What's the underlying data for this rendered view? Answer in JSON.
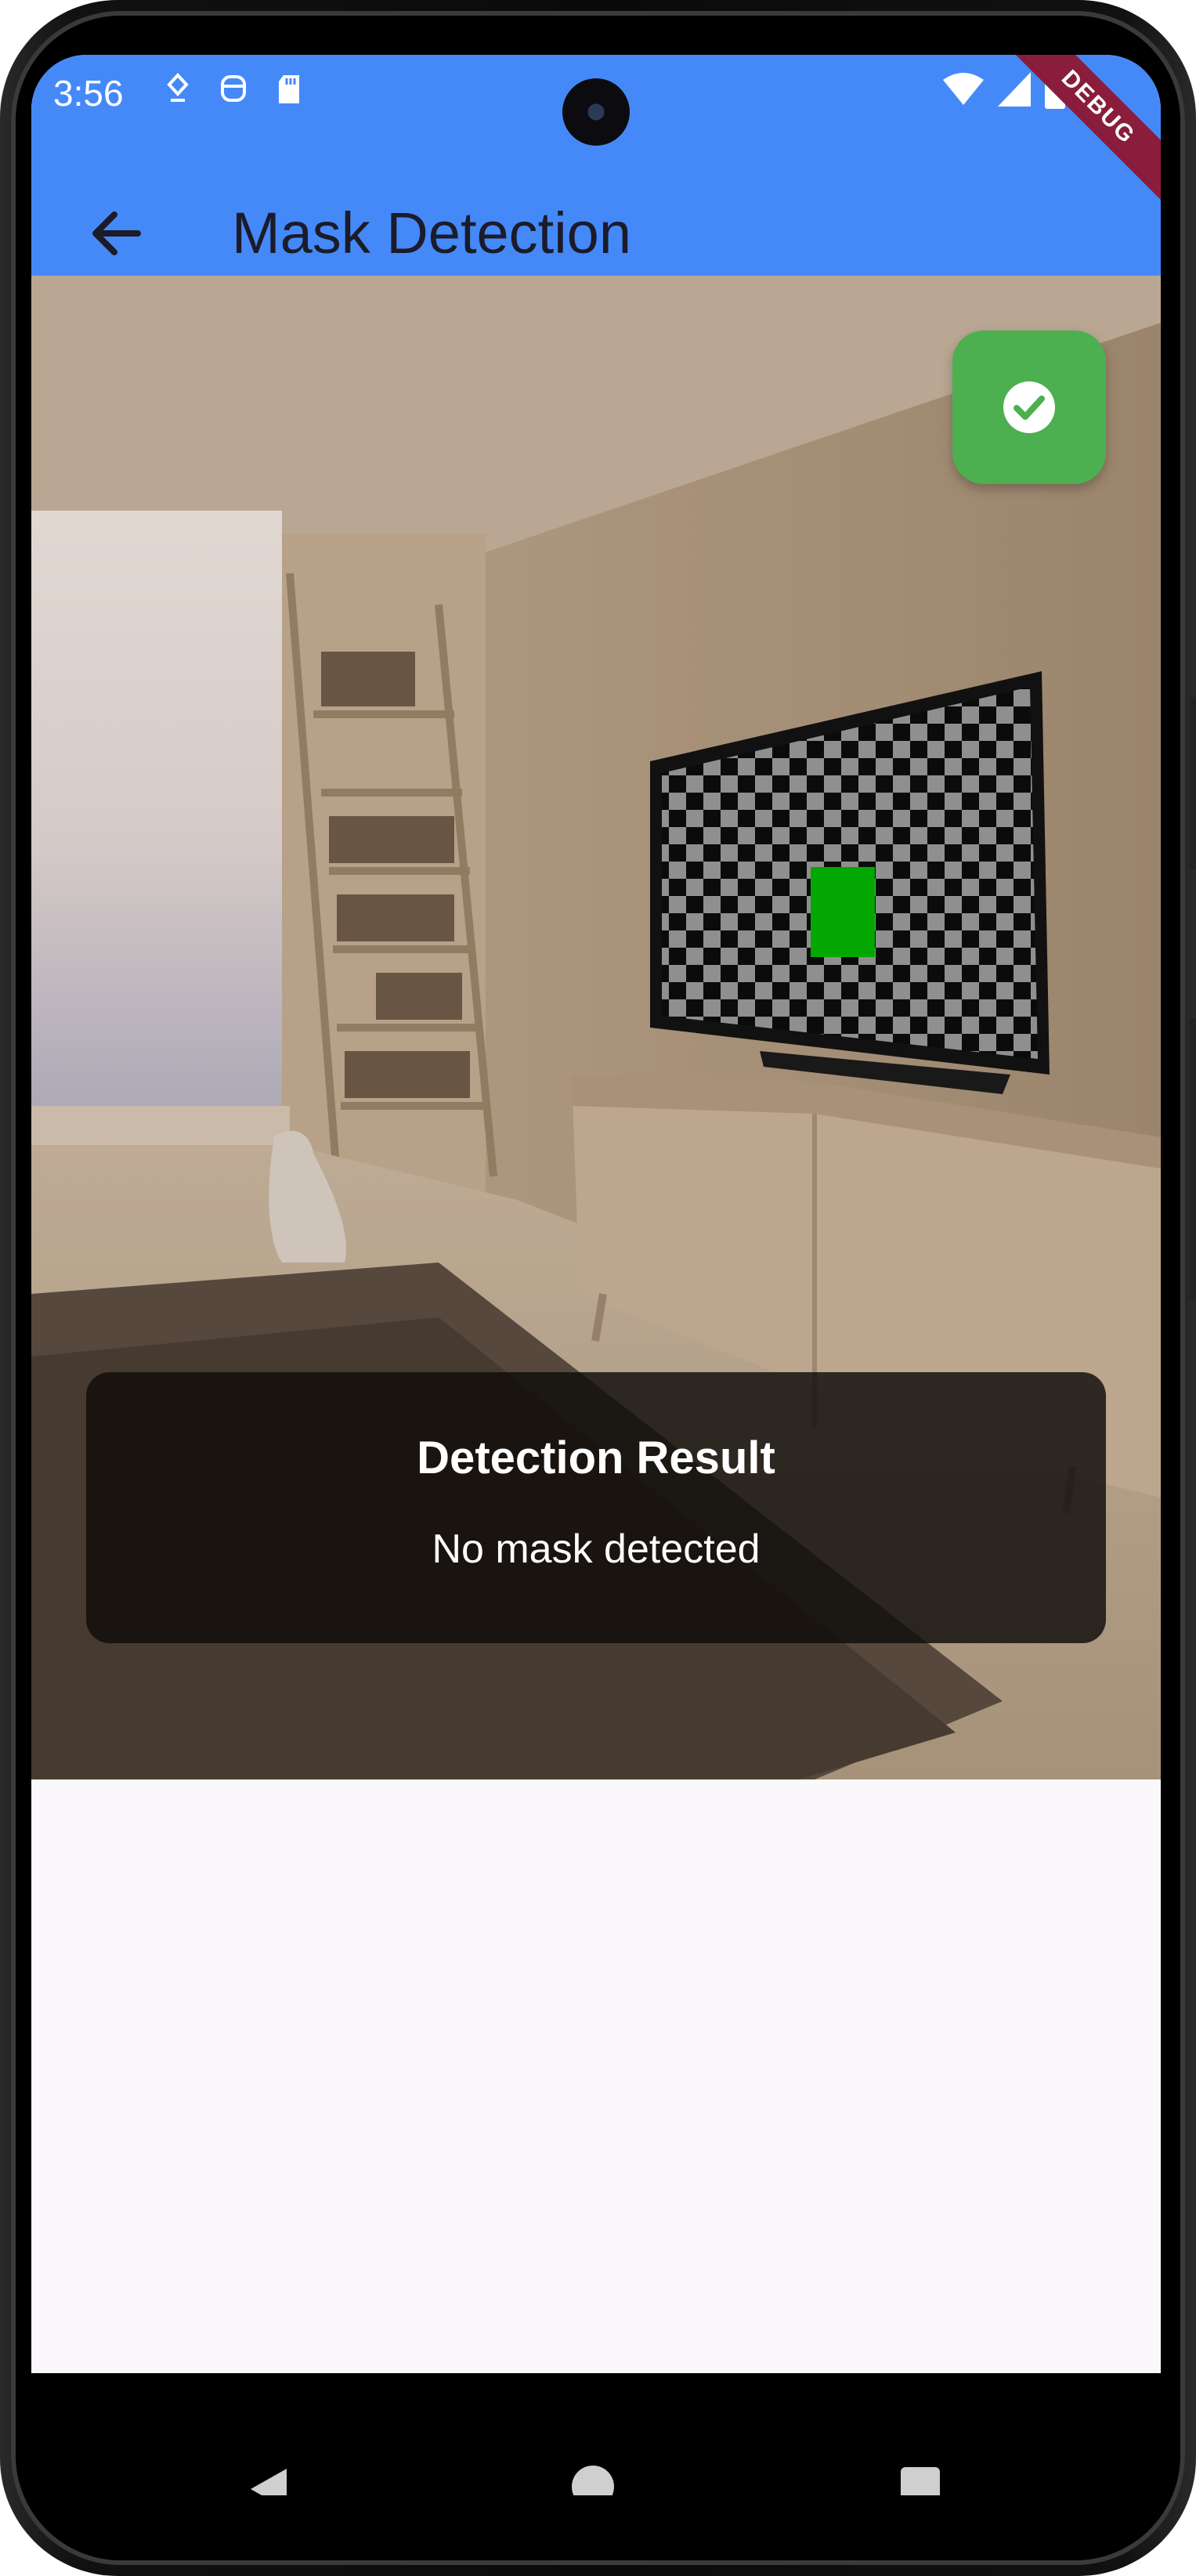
{
  "status_bar": {
    "time": "3:56",
    "left_icons": [
      "location-icon",
      "face-icon",
      "sd-card-icon"
    ],
    "right_icons": [
      "wifi-icon",
      "signal-icon",
      "battery-icon"
    ],
    "debug_banner": "DEBUG"
  },
  "app_bar": {
    "title": "Mask Detection",
    "back_icon": "arrow-left-icon",
    "color": "#4589f8"
  },
  "main": {
    "status_button_icon": "check-circle-icon",
    "status_button_color": "#4caf50",
    "result": {
      "title": "Detection Result",
      "message": "No mask detected"
    }
  },
  "nav_bar": {
    "icons": [
      "nav-back-icon",
      "nav-home-icon",
      "nav-recents-icon"
    ]
  }
}
